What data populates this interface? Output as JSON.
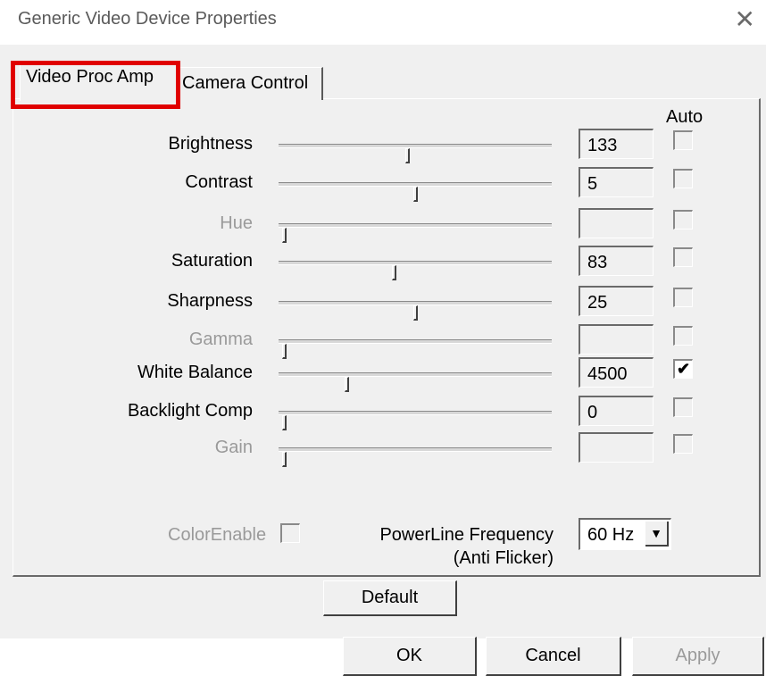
{
  "window": {
    "title": "Generic Video Device Properties",
    "close_glyph": "✕"
  },
  "tabs": [
    {
      "label": "Video Proc Amp",
      "active": true
    },
    {
      "label": "Camera Control",
      "active": false
    }
  ],
  "auto_header": "Auto",
  "controls": [
    {
      "label": "Brightness",
      "value": "133",
      "level": 0.47,
      "auto": false,
      "enabled": true
    },
    {
      "label": "Contrast",
      "value": "5",
      "level": 0.5,
      "auto": false,
      "enabled": true
    },
    {
      "label": "Hue",
      "value": "",
      "level": 0.0,
      "auto": false,
      "enabled": false
    },
    {
      "label": "Saturation",
      "value": "83",
      "level": 0.42,
      "auto": false,
      "enabled": true
    },
    {
      "label": "Sharpness",
      "value": "25",
      "level": 0.5,
      "auto": false,
      "enabled": true
    },
    {
      "label": "Gamma",
      "value": "",
      "level": 0.0,
      "auto": false,
      "enabled": false
    },
    {
      "label": "White Balance",
      "value": "4500",
      "level": 0.24,
      "auto": true,
      "enabled": true
    },
    {
      "label": "Backlight Comp",
      "value": "0",
      "level": 0.0,
      "auto": false,
      "enabled": true
    },
    {
      "label": "Gain",
      "value": "",
      "level": 0.0,
      "auto": false,
      "enabled": false
    }
  ],
  "color_enable": {
    "label": "ColorEnable",
    "checked": false
  },
  "powerline": {
    "label_line1": "PowerLine Frequency",
    "label_line2": "(Anti Flicker)",
    "value": "60 Hz",
    "arrow_glyph": "▼"
  },
  "buttons": {
    "default": "Default",
    "ok": "OK",
    "cancel": "Cancel",
    "apply": "Apply"
  },
  "check_glyph": "✔",
  "colors": {
    "highlight": "#e00000",
    "disabled_text": "#9a9a9a",
    "dialog_bg": "#f0f0f0"
  }
}
